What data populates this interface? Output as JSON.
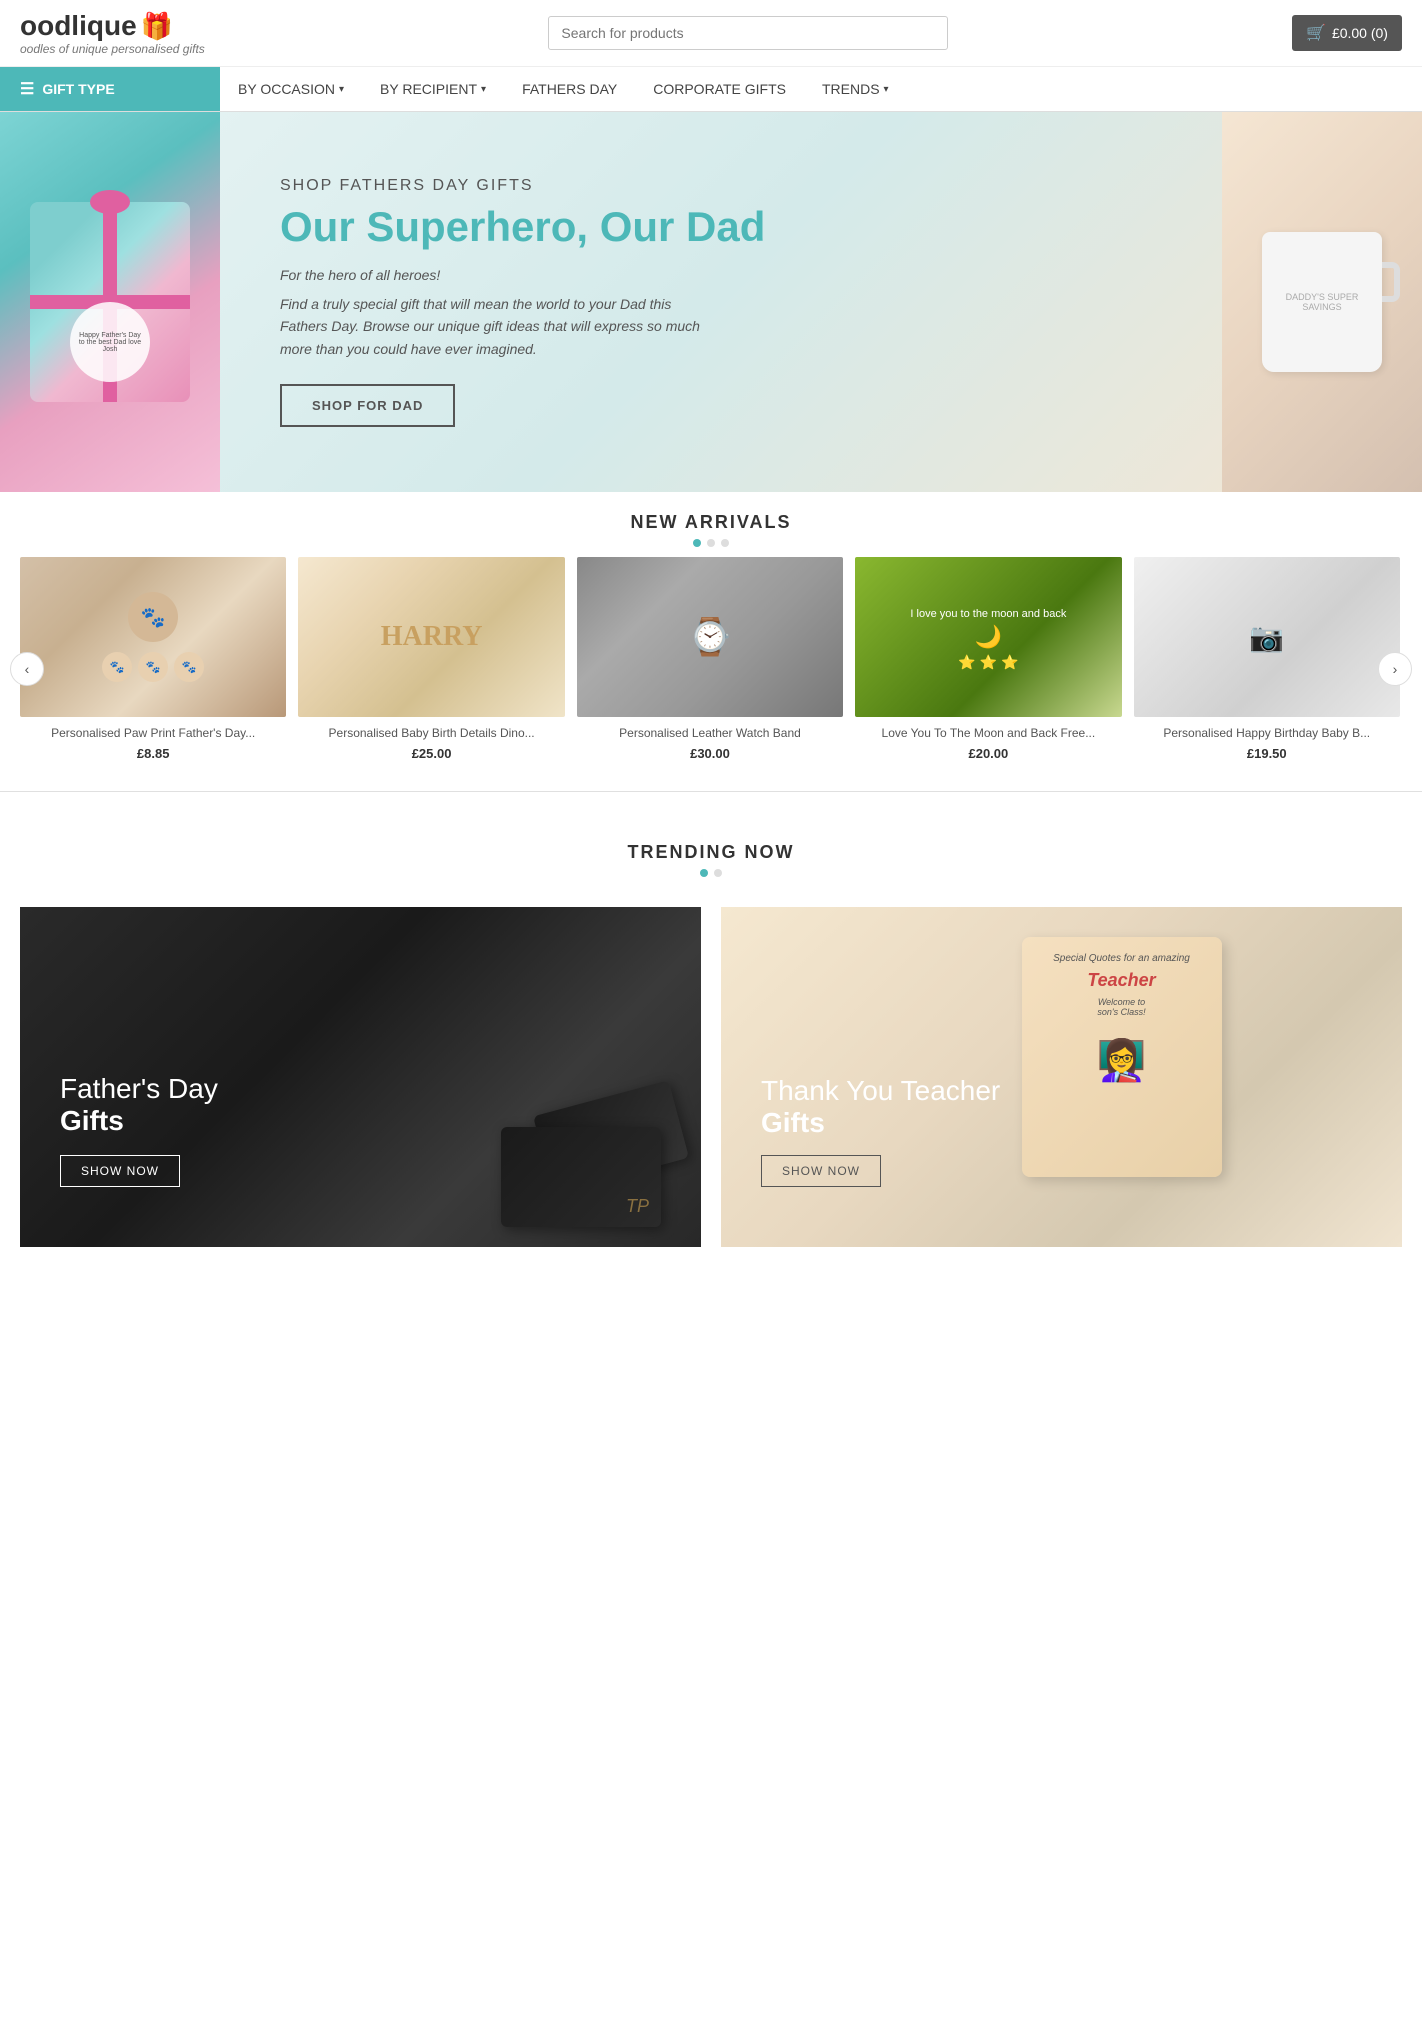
{
  "header": {
    "logo_text": "oodlique",
    "logo_tagline": "oodles of unique personalised gifts",
    "search_placeholder": "Search for products",
    "cart_label": "£0.00 (0)"
  },
  "nav": {
    "gift_type_label": "GIFT TYPE",
    "links": [
      {
        "label": "BY OCCASION",
        "has_arrow": true
      },
      {
        "label": "BY RECIPIENT",
        "has_arrow": true
      },
      {
        "label": "FATHERS DAY",
        "has_arrow": false
      },
      {
        "label": "CORPORATE GIFTS",
        "has_arrow": false
      },
      {
        "label": "TRENDS",
        "has_arrow": true
      }
    ]
  },
  "hero": {
    "subtitle": "SHOP FATHERS DAY GIFTS",
    "title": "Our Superhero, Our Dad",
    "for_hero": "For the hero of all heroes!",
    "description": "Find a truly special gift that will mean the world to your Dad this Fathers Day. Browse our unique gift ideas that will express so much more than you could have ever imagined.",
    "cta_label": "SHOP FOR DAD",
    "gift_tag_text": "Happy Father's Day to the best Dad love Josh"
  },
  "new_arrivals": {
    "section_title": "NEW ARRIVALS",
    "products": [
      {
        "name": "Personalised Paw Print Father's Day...",
        "price": "£8.85"
      },
      {
        "name": "Personalised Baby Birth Details Dino...",
        "price": "£25.00"
      },
      {
        "name": "Personalised Leather Watch Band",
        "price": "£30.00"
      },
      {
        "name": "Love You To The Moon and Back Free...",
        "price": "£20.00"
      },
      {
        "name": "Personalised Happy Birthday Baby B...",
        "price": "£19.50"
      }
    ]
  },
  "trending": {
    "section_title": "TRENDING NOW"
  },
  "bottom_banners": [
    {
      "title_line1": "Father's Day",
      "title_line2": "Gifts",
      "cta_label": "SHOW NOW"
    },
    {
      "title_line1": "Thank You Teacher",
      "title_line2": "Gifts",
      "cta_label": "SHOW NOW",
      "card_quote": "Special Quotes for an amazing",
      "card_name": "Teacher",
      "card_sub": "Welcome to",
      "card_class": "son's Class!"
    }
  ]
}
